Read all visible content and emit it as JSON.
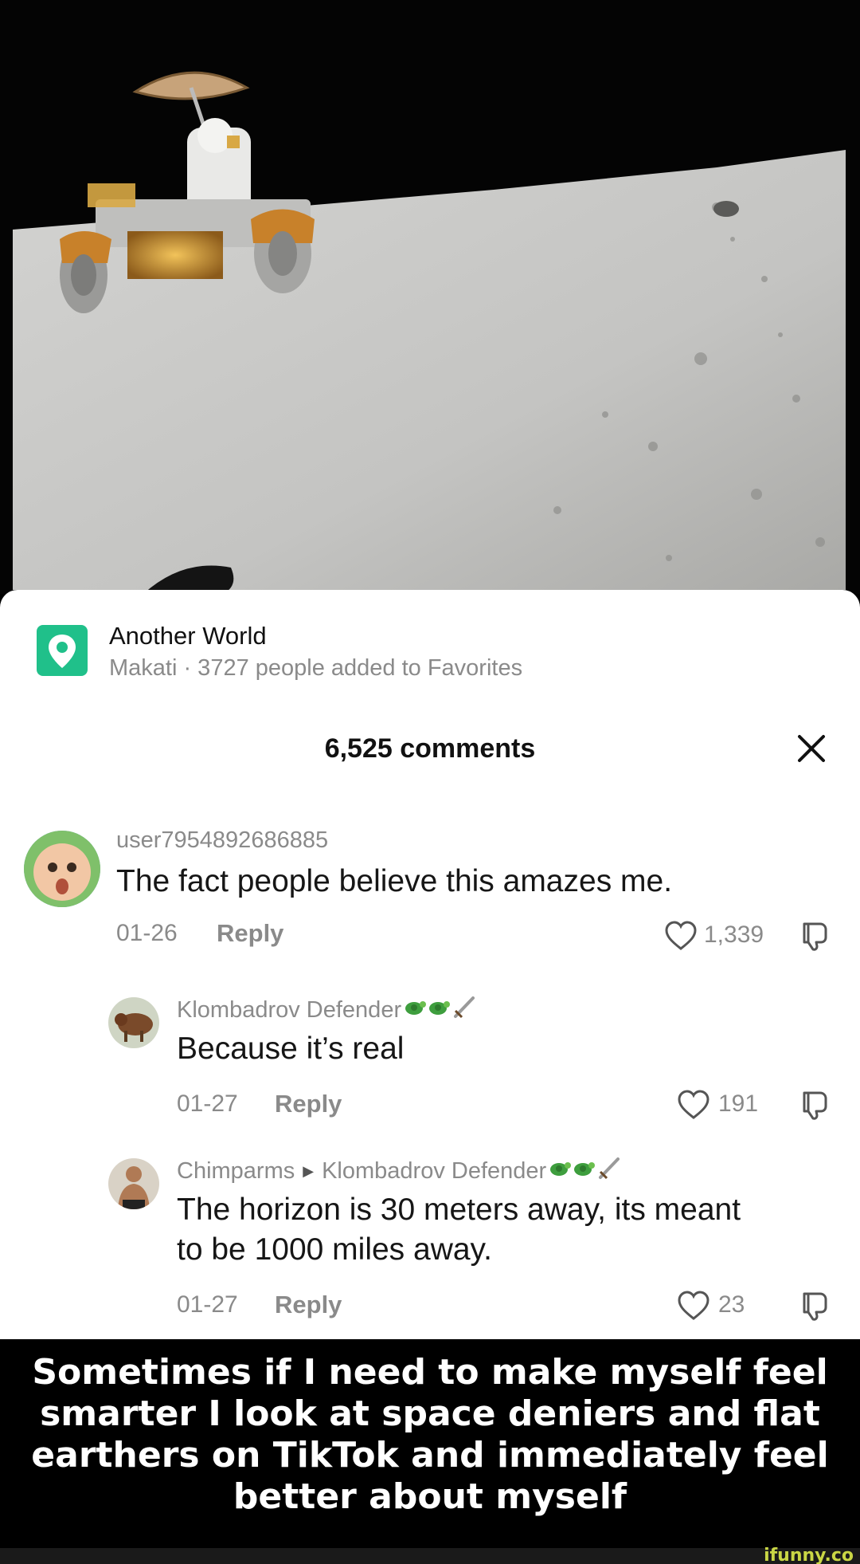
{
  "place": {
    "title": "Another World",
    "subtitle": "Makati · 3727 people added to Favorites",
    "icon": "location-pin-icon"
  },
  "comments_header": {
    "count_label": "6,525 comments",
    "close_icon": "close-icon"
  },
  "comments": [
    {
      "username": "user7954892686885",
      "text": "The fact people believe this amazes me.",
      "date": "01-26",
      "reply_label": "Reply",
      "likes": "1,339"
    },
    {
      "username": "Klombadrov Defender",
      "username_emojis": [
        "turtle-icon",
        "turtle-icon",
        "dagger-icon"
      ],
      "text": "Because it’s real",
      "date": "01-27",
      "reply_label": "Reply",
      "likes": "191"
    },
    {
      "username": "Chimparms",
      "reply_to": "Klombadrov Defender",
      "username_emojis": [
        "turtle-icon",
        "turtle-icon",
        "dagger-icon"
      ],
      "text_lines": [
        "The horizon is 30 meters away, its meant",
        "to be 1000 miles away."
      ],
      "date": "01-27",
      "reply_label": "Reply",
      "likes": "23"
    }
  ],
  "caption": {
    "lines": [
      "Sometimes if I need to make myself feel",
      "smarter I look at space deniers and flat",
      "earthers on TikTok and immediately feel",
      "better about myself"
    ]
  },
  "watermark": "ifunny.co",
  "colors": {
    "pin_green": "#20c08a",
    "meta_gray": "#8a8a8a",
    "watermark": "#c9d645"
  }
}
